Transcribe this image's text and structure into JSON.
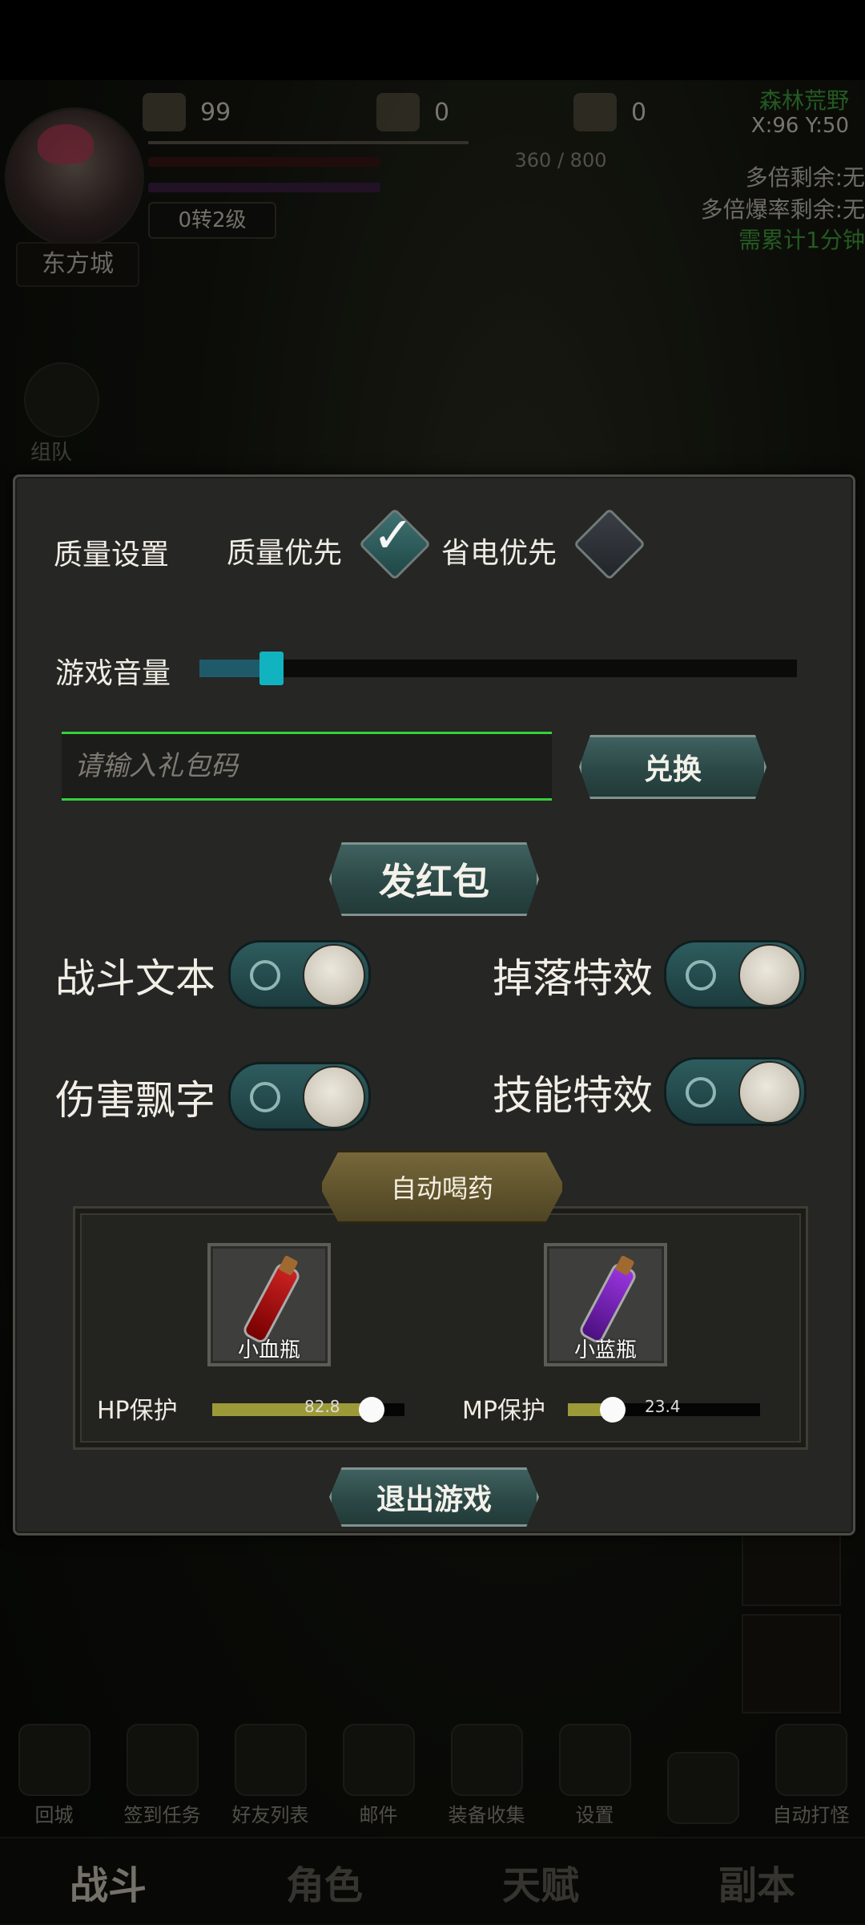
{
  "hud": {
    "res_a": "99",
    "res_b": "0",
    "res_c": "0",
    "zone": "森林荒野",
    "coord": "X:96 Y:50",
    "exp": "360 / 800",
    "level": "0转2级",
    "city": "东方城",
    "mult1": "多倍剩余:无",
    "mult2": "多倍爆率剩余:无",
    "need": "需累计1分钟",
    "team": "组队",
    "bottom_icons": [
      "回城",
      "签到任务",
      "好友列表",
      "邮件",
      "装备收集",
      "设置",
      "",
      "自动打怪"
    ],
    "tabs": [
      "战斗",
      "角色",
      "天赋",
      "副本"
    ]
  },
  "settings": {
    "quality_label": "质量设置",
    "quality_first": "质量优先",
    "power_saving": "省电优先",
    "volume_label": "游戏音量",
    "volume_level": 0.12,
    "gift_placeholder": "请输入礼包码",
    "redeem": "兑换",
    "red_packet": "发红包",
    "toggles": {
      "battle_text": "战斗文本",
      "drop_effect": "掉落特效",
      "damage_float": "伤害飘字",
      "skill_effect": "技能特效"
    },
    "auto_potion": "自动喝药",
    "hp_potion": "小血瓶",
    "mp_potion": "小蓝瓶",
    "hp_label": "HP保护",
    "hp_value": "82.8",
    "mp_label": "MP保护",
    "mp_value": "23.4",
    "exit": "退出游戏"
  },
  "colors": {
    "accent": "#12b3c0",
    "input_border": "#35d13b",
    "zone_green": "#3e9b3a",
    "slider_fill": "#9c9a38"
  }
}
